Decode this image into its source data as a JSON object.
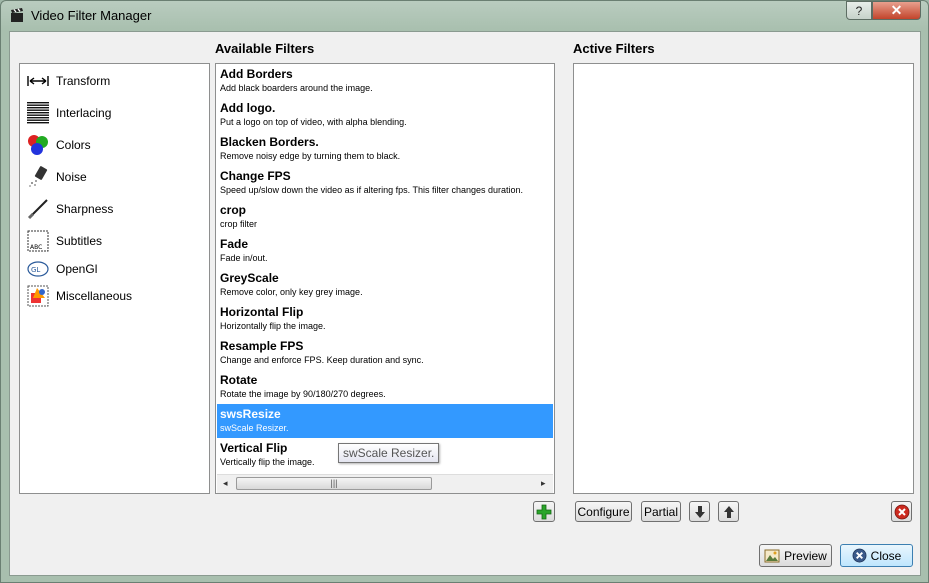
{
  "window": {
    "title": "Video Filter Manager",
    "help_label": "?",
    "close_label": "✕"
  },
  "headings": {
    "available": "Available Filters",
    "active": "Active Filters"
  },
  "categories": [
    {
      "label": "Transform",
      "icon": "transform-icon"
    },
    {
      "label": "Interlacing",
      "icon": "interlacing-icon"
    },
    {
      "label": "Colors",
      "icon": "colors-icon"
    },
    {
      "label": "Noise",
      "icon": "noise-icon"
    },
    {
      "label": "Sharpness",
      "icon": "sharpness-icon"
    },
    {
      "label": "Subtitles",
      "icon": "subtitles-icon"
    },
    {
      "label": "OpenGl",
      "icon": "opengl-icon"
    },
    {
      "label": "Miscellaneous",
      "icon": "miscellaneous-icon"
    }
  ],
  "filters": [
    {
      "name": "Add Borders",
      "desc": "Add black boarders around the image."
    },
    {
      "name": "Add logo.",
      "desc": "Put a logo on top of video, with alpha blending."
    },
    {
      "name": "Blacken Borders.",
      "desc": "Remove noisy edge by turning them to black."
    },
    {
      "name": "Change FPS",
      "desc": "Speed up/slow down the video as if altering fps. This filter changes duration."
    },
    {
      "name": "crop",
      "desc": "crop filter"
    },
    {
      "name": "Fade",
      "desc": "Fade in/out."
    },
    {
      "name": "GreyScale",
      "desc": "Remove color, only key grey image."
    },
    {
      "name": "Horizontal Flip",
      "desc": "Horizontally flip the image."
    },
    {
      "name": "Resample FPS",
      "desc": "Change and enforce FPS. Keep duration and sync."
    },
    {
      "name": "Rotate",
      "desc": "Rotate the image by 90/180/270 degrees."
    },
    {
      "name": "swsResize",
      "desc": "swScale Resizer."
    },
    {
      "name": "Vertical Flip",
      "desc": "Vertically flip the image."
    }
  ],
  "selected_filter": "swsResize",
  "tooltip": "swScale Resizer.",
  "scrollbar": {
    "left_arrow": "◂",
    "right_arrow": "▸",
    "grip": "|||"
  },
  "buttons": {
    "configure": "Configure",
    "partial": "Partial",
    "preview": "Preview",
    "close": "Close"
  },
  "colors": {
    "selection": "#3399ff",
    "add_green": "#2aa52a",
    "remove_red": "#cc2a1f"
  }
}
